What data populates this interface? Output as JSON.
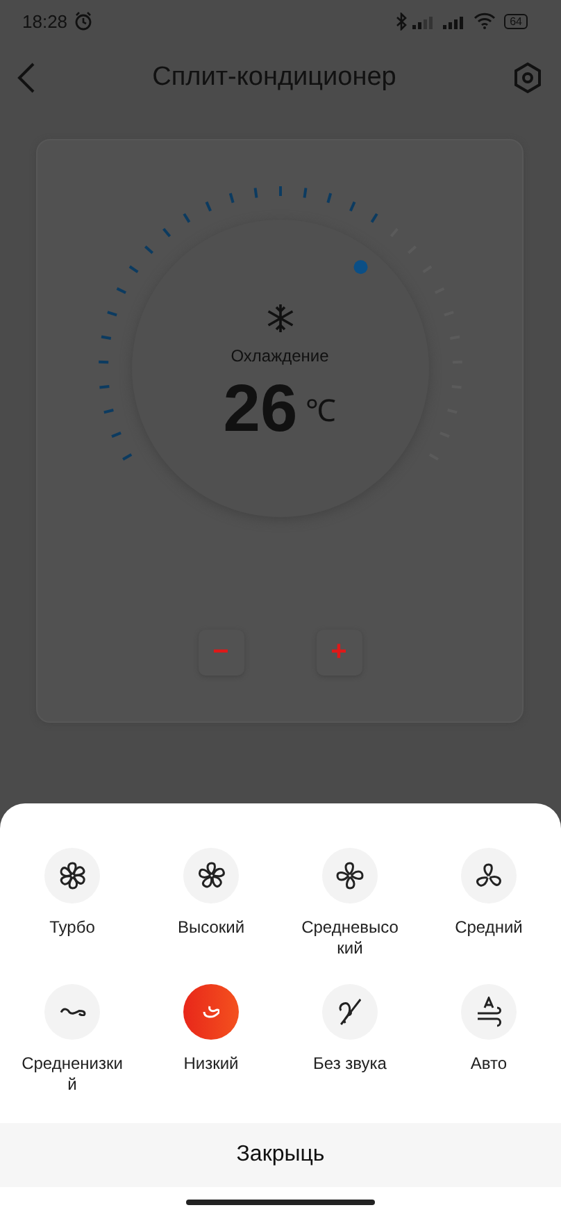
{
  "status_bar": {
    "time": "18:28",
    "battery": "64"
  },
  "header": {
    "title": "Сплит-кондиционер"
  },
  "thermostat": {
    "mode": "Охлаждение",
    "temperature": "26",
    "unit": "℃",
    "minus": "−",
    "plus": "+"
  },
  "fan_sheet": {
    "modes": [
      {
        "label": "Турбо",
        "kind": "turbo",
        "selected": false
      },
      {
        "label": "Высокий",
        "kind": "high",
        "selected": false
      },
      {
        "label": "Средневысокий",
        "kind": "midhigh",
        "selected": false
      },
      {
        "label": "Средний",
        "kind": "mid",
        "selected": false
      },
      {
        "label": "Средненизкий",
        "kind": "midlow",
        "selected": false
      },
      {
        "label": "Низкий",
        "kind": "low",
        "selected": true
      },
      {
        "label": "Без звука",
        "kind": "mute",
        "selected": false
      },
      {
        "label": "Авто",
        "kind": "auto",
        "selected": false
      }
    ],
    "close": "Закрыць"
  }
}
